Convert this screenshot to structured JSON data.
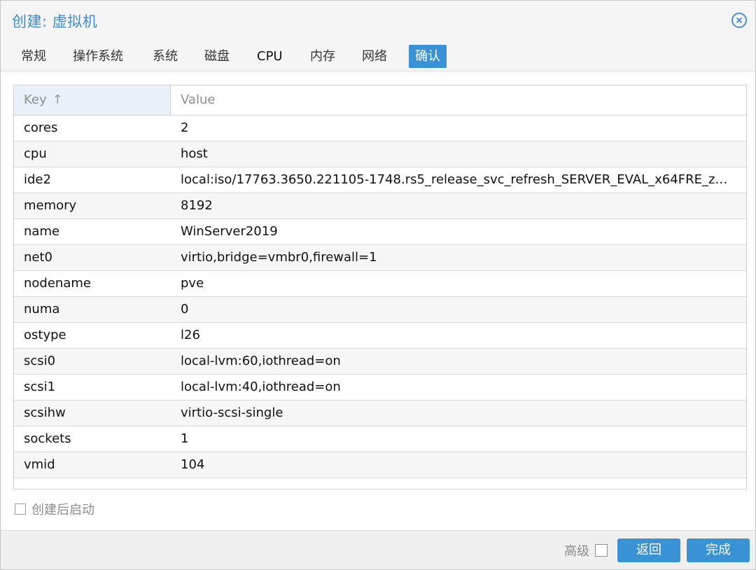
{
  "window": {
    "title": "创建: 虚拟机"
  },
  "tabs": [
    {
      "label": "常规"
    },
    {
      "label": "操作系统"
    },
    {
      "label": "系统"
    },
    {
      "label": "磁盘"
    },
    {
      "label": "CPU"
    },
    {
      "label": "内存"
    },
    {
      "label": "网络"
    },
    {
      "label": "确认",
      "active": true
    }
  ],
  "grid": {
    "columns": {
      "key": "Key",
      "value": "Value"
    },
    "sort_indicator": "↑",
    "rows": [
      {
        "key": "cores",
        "value": "2"
      },
      {
        "key": "cpu",
        "value": "host"
      },
      {
        "key": "ide2",
        "value": "local:iso/17763.3650.221105-1748.rs5_release_svc_refresh_SERVER_EVAL_x64FRE_z…"
      },
      {
        "key": "memory",
        "value": "8192"
      },
      {
        "key": "name",
        "value": "WinServer2019"
      },
      {
        "key": "net0",
        "value": "virtio,bridge=vmbr0,firewall=1"
      },
      {
        "key": "nodename",
        "value": "pve"
      },
      {
        "key": "numa",
        "value": "0"
      },
      {
        "key": "ostype",
        "value": "l26"
      },
      {
        "key": "scsi0",
        "value": "local-lvm:60,iothread=on"
      },
      {
        "key": "scsi1",
        "value": "local-lvm:40,iothread=on"
      },
      {
        "key": "scsihw",
        "value": "virtio-scsi-single"
      },
      {
        "key": "sockets",
        "value": "1"
      },
      {
        "key": "vmid",
        "value": "104"
      }
    ]
  },
  "autostart": {
    "label": "创建后启动",
    "checked": false
  },
  "footer": {
    "advanced_label": "高级",
    "advanced_checked": false,
    "back_label": "返回",
    "finish_label": "完成"
  },
  "colors": {
    "accent": "#3892d4",
    "title": "#3d8ad0"
  }
}
